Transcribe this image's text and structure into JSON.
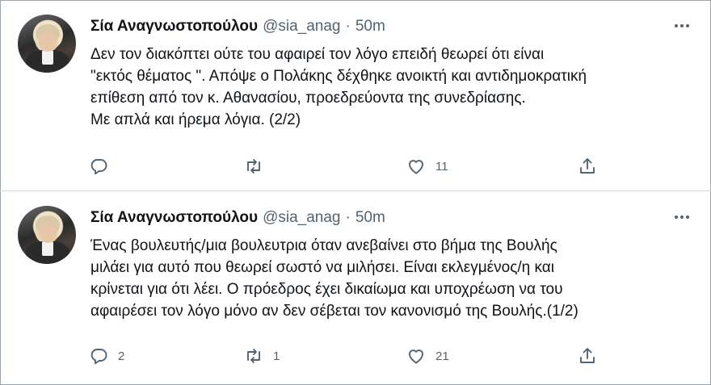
{
  "tweets": [
    {
      "name": "Σία Αναγνωστοπούλου",
      "handle": "@sia_anag",
      "separator": "·",
      "time": "50m",
      "lines": [
        "Δεν τον διακόπτει ούτε του αφαιρεί τον λόγο επειδή θεωρεί ότι είναι",
        "\"εκτός θέματος \". Απόψε ο Πολάκης δέχθηκε ανοικτή και αντιδημοκρατική",
        "επίθεση από τον κ. Αθανασίου,  προεδρεύοντα της συνεδρίασης.",
        "Με απλά και ήρεμα λόγια. (2/2)"
      ],
      "reply_count": "",
      "retweet_count": "",
      "like_count": "11"
    },
    {
      "name": "Σία Αναγνωστοπούλου",
      "handle": "@sia_anag",
      "separator": "·",
      "time": "50m",
      "lines": [
        "Ένας βουλευτής/μια βουλευτρια όταν ανεβαίνει στο βήμα της Βουλής",
        "μιλάει για αυτό που θεωρεί σωστό να μιλήσει.  Είναι εκλεγμένος/η και",
        "κρίνεται για ότι λέει.  Ο πρόεδρος έχει δικαίωμα και υποχρέωση να του",
        "αφαιρέσει τον λόγο μόνο αν δεν σέβεται τον κανονισμό της Βουλής.(1/2)"
      ],
      "reply_count": "2",
      "retweet_count": "1",
      "like_count": "21"
    }
  ],
  "icons": {
    "reply": "reply-icon",
    "retweet": "retweet-icon",
    "like": "like-icon",
    "share": "share-icon",
    "more": "more-icon"
  },
  "colors": {
    "text": "#0f1419",
    "secondary": "#536471",
    "divider": "#d6dbde"
  }
}
